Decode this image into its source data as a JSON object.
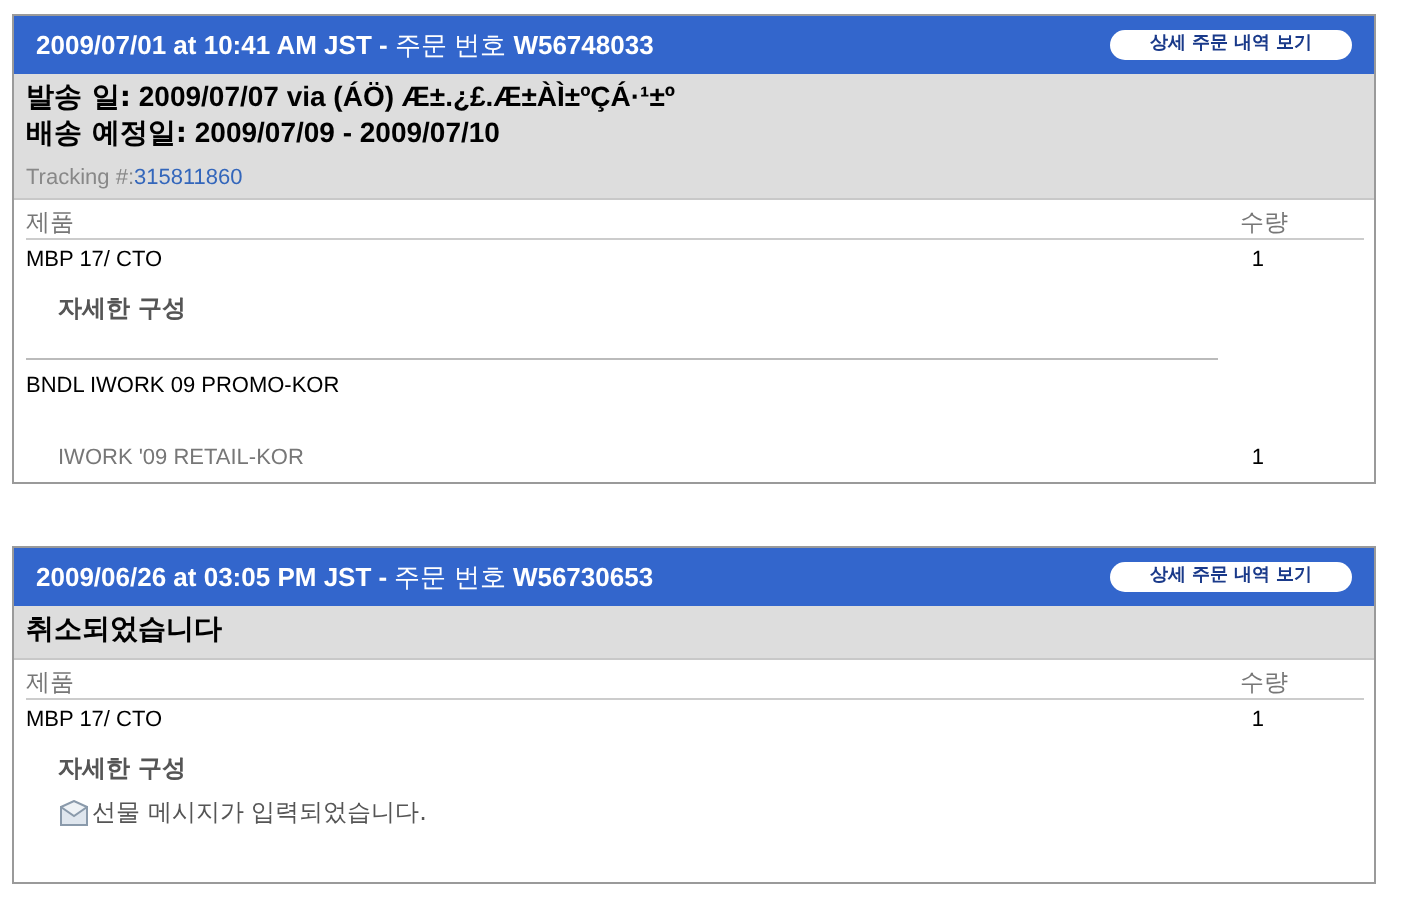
{
  "orders": [
    {
      "header": "**2009/07/01 at 10:41 AM JST -** 주문 번호 **W56748033**",
      "details_button": "상세 주문 내역 보기",
      "summary": [
        {
          "kind": "line",
          "label": "발송 일:",
          "value": "2009/07/07 via (ÁÖ) Æ±.¿£.Æ±ÀÌ±ºÇÁ·¹±º"
        },
        {
          "kind": "line",
          "label": "배송 예정일:",
          "value": "2009/07/09 - 2009/07/10"
        },
        {
          "kind": "tracking",
          "label": "Tracking #:",
          "value": "315811860"
        }
      ],
      "columns": [
        "제품",
        "수량"
      ],
      "items": [
        {
          "kind": "product",
          "name": "MBP 17/ CTO",
          "qty": "1"
        },
        {
          "kind": "config",
          "name": "자세한 구성"
        },
        {
          "kind": "product",
          "name": "BNDL IWORK 09 PROMO-KOR",
          "divider": true
        },
        {
          "kind": "subitem",
          "name": "IWORK '09 RETAIL-KOR",
          "qty": "1"
        }
      ]
    },
    {
      "header": "**2009/06/26 at 03:05 PM JST -** 주문 번호 **W56730653**",
      "details_button": "상세 주문 내역 보기",
      "summary": [
        {
          "kind": "status",
          "value": "취소되었습니다"
        }
      ],
      "columns": [
        "제품",
        "수량"
      ],
      "items": [
        {
          "kind": "product",
          "name": "MBP 17/ CTO",
          "qty": "1"
        },
        {
          "kind": "config",
          "name": "자세한 구성"
        },
        {
          "kind": "gift",
          "name": "선물 메시지가 입력되었습니다."
        }
      ]
    }
  ]
}
